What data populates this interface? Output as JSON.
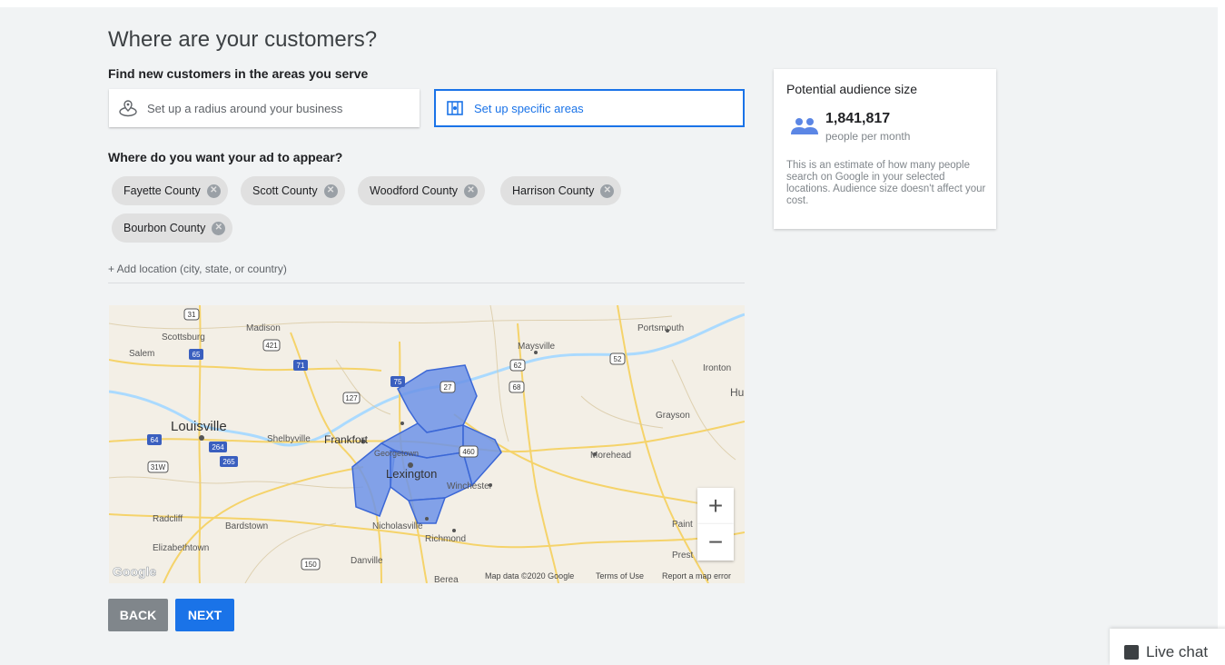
{
  "page": {
    "title": "Where are your customers?",
    "serve_label": "Find new customers in the areas you serve",
    "appear_label": "Where do you want your ad to appear?"
  },
  "options": {
    "radius_label": "Set up a radius around your business",
    "areas_label": "Set up specific areas",
    "selected": "areas"
  },
  "locations": [
    "Fayette County",
    "Scott County",
    "Woodford County",
    "Harrison County",
    "Bourbon County"
  ],
  "add_location": {
    "label": "+ Add location (city, state, or country)"
  },
  "map": {
    "cities": [
      "Madison",
      "Scottsburg",
      "Salem",
      "Louisville",
      "Shelbyville",
      "Frankfort",
      "Georgetown",
      "Lexington",
      "Winchester",
      "Nicholasville",
      "Richmond",
      "Danville",
      "Berea",
      "Bardstown",
      "Radcliff",
      "Elizabethtown",
      "Maysville",
      "Portsmouth",
      "Ironton",
      "Grayson",
      "Morehead",
      "Paint",
      "Prest",
      "Hu"
    ],
    "highways": [
      "31",
      "421",
      "65",
      "71",
      "127",
      "75",
      "27",
      "62",
      "68",
      "52",
      "64",
      "264",
      "265",
      "31W",
      "460",
      "150"
    ],
    "zoom_in": "+",
    "zoom_out": "−",
    "logo": "Google",
    "attribution": "Map data ©2020 Google",
    "terms": "Terms of Use",
    "report": "Report a map error"
  },
  "buttons": {
    "back": "BACK",
    "next": "NEXT"
  },
  "audience": {
    "title": "Potential audience size",
    "number": "1,841,817",
    "unit": "people per month",
    "description": "This is an estimate of how many people search on Google in your selected locations. Audience size doesn't affect your cost."
  },
  "live_chat": {
    "label": "Live chat"
  },
  "colors": {
    "accent": "#1a73e8",
    "region_fill": "#6d93e8",
    "back_button": "#80868b"
  }
}
